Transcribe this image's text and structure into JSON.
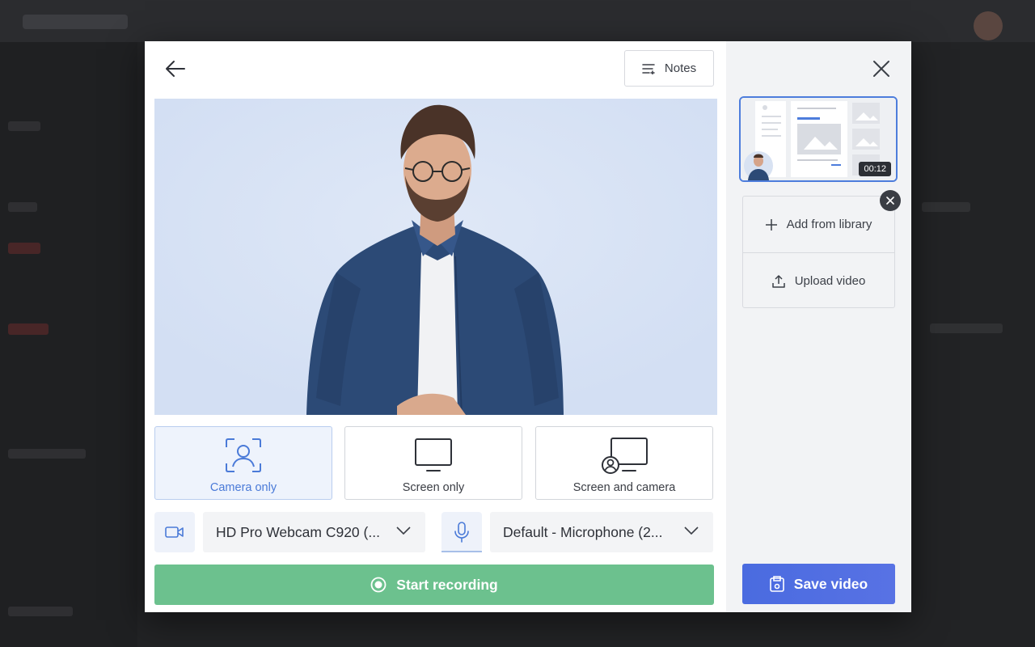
{
  "header": {
    "back_icon": "arrow-left-icon",
    "notes_label": "Notes",
    "notes_icon": "notes-list-icon",
    "close_icon": "close-icon"
  },
  "preview": {
    "background_color": "#d5e1f4"
  },
  "modes": [
    {
      "label": "Camera only",
      "icon": "camera-frame-icon",
      "active": true
    },
    {
      "label": "Screen only",
      "icon": "monitor-icon",
      "active": false
    },
    {
      "label": "Screen and camera",
      "icon": "screen-camera-icon",
      "active": false
    }
  ],
  "devices": {
    "camera_icon": "video-camera-icon",
    "camera_value": "HD Pro Webcam C920 (...",
    "mic_icon": "microphone-icon",
    "mic_value": "Default - Microphone (2..."
  },
  "record": {
    "label": "Start recording",
    "icon": "record-icon",
    "color": "#6cc18e"
  },
  "sidebar": {
    "thumbnail_time": "00:12",
    "add_from_library": "Add from library",
    "upload_video": "Upload video",
    "save_label": "Save video",
    "save_color": "#4a6be0",
    "selected_border": "#4d7ddc"
  }
}
